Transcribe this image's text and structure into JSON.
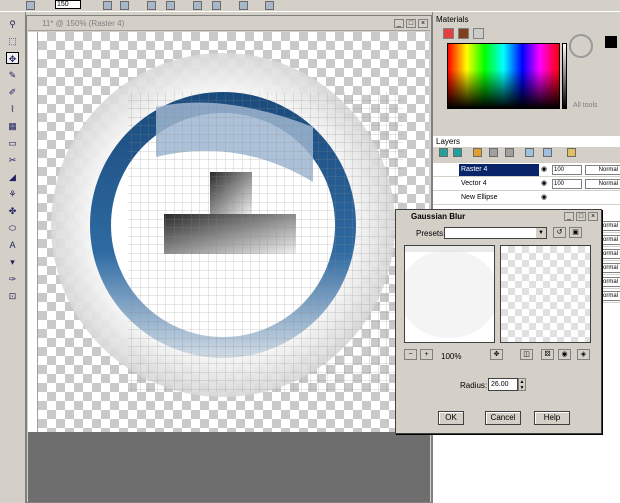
{
  "top_toolbar": {
    "zoom_value": "150"
  },
  "tools": [
    "⚲",
    "⬚",
    "✥",
    "✎",
    "✐",
    "⌇",
    "▦",
    "▭",
    "✂",
    "◢",
    "⚘",
    "✤",
    "⬭",
    "A",
    "▾",
    "✑",
    "⊡"
  ],
  "document": {
    "title": "11* @ 150% (Raster 4)",
    "minimize": "_",
    "maximize": "□",
    "close": "×"
  },
  "materials": {
    "title": "Materials",
    "all_tools_label": "All tools"
  },
  "layers": {
    "title": "Layers",
    "rows": [
      {
        "name": "Raster 4",
        "opacity": "100",
        "blend": "Normal",
        "selected": true
      },
      {
        "name": "Vector 4",
        "opacity": "100",
        "blend": "Normal",
        "selected": false
      },
      {
        "name": "New Ellipse",
        "opacity": "",
        "blend": "",
        "selected": false
      }
    ],
    "extra_blends": [
      "Normal",
      "Normal",
      "Normal",
      "Normal",
      "Normal",
      "Normal"
    ]
  },
  "dialog": {
    "title": "Gaussian Blur",
    "presets_label": "Presets:",
    "zoom_label": "100%",
    "radius_label": "Radius:",
    "radius_value": "26.00",
    "ok_label": "OK",
    "cancel_label": "Cancel",
    "help_label": "Help"
  },
  "colors": {
    "selection": "#0a246a",
    "ring_blue": "#1f4f82",
    "panel": "#d4d0c8"
  }
}
